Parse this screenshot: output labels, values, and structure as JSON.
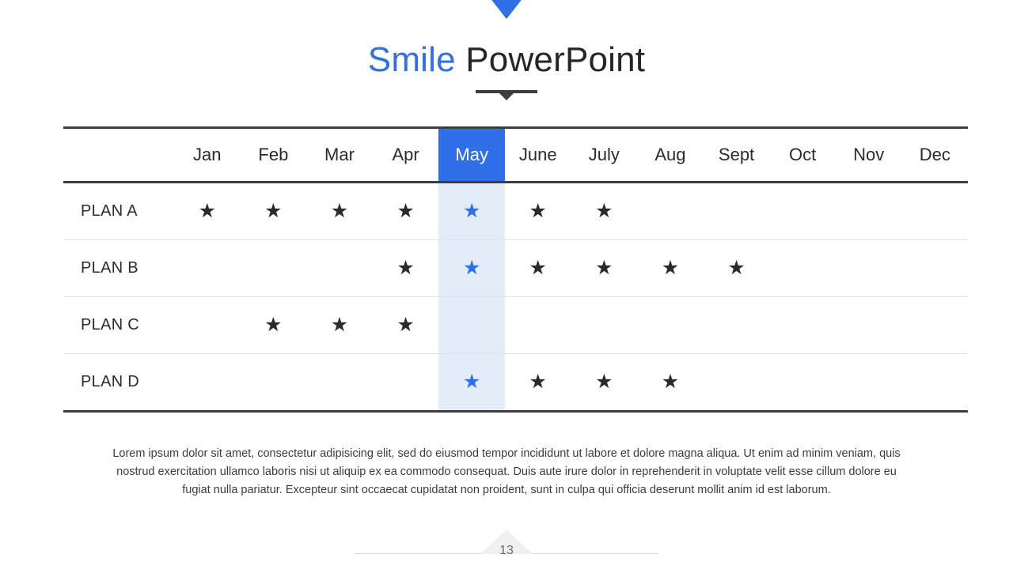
{
  "slide": {
    "title_accent": "Smile",
    "title_rest": " PowerPoint",
    "page_number": "13",
    "accent_color": "#2f6fe8",
    "highlight_fill": "#e3ecf7",
    "star_glyph": "★"
  },
  "table": {
    "row_header_label": "",
    "columns": [
      "Jan",
      "Feb",
      "Mar",
      "Apr",
      "May",
      "June",
      "July",
      "Aug",
      "Sept",
      "Oct",
      "Nov",
      "Dec"
    ],
    "highlighted_column": "May",
    "highlighted_column_index": 4,
    "rows": [
      {
        "label": "PLAN A",
        "marks": [
          true,
          true,
          true,
          true,
          true,
          true,
          true,
          false,
          false,
          false,
          false,
          false
        ]
      },
      {
        "label": "PLAN B",
        "marks": [
          false,
          false,
          false,
          true,
          true,
          true,
          true,
          true,
          true,
          false,
          false,
          false
        ]
      },
      {
        "label": "PLAN C",
        "marks": [
          false,
          true,
          true,
          true,
          false,
          false,
          false,
          false,
          false,
          false,
          false,
          false
        ]
      },
      {
        "label": "PLAN D",
        "marks": [
          false,
          false,
          false,
          false,
          true,
          true,
          true,
          true,
          false,
          false,
          false,
          false
        ]
      }
    ]
  },
  "body": {
    "paragraph": "Lorem ipsum dolor sit amet, consectetur adipisicing elit, sed do eiusmod tempor incididunt ut labore et dolore magna aliqua. Ut enim ad minim veniam, quis nostrud exercitation ullamco laboris nisi ut aliquip ex ea commodo consequat. Duis aute irure dolor in reprehenderit in voluptate velit esse cillum dolore eu fugiat nulla pariatur. Excepteur sint occaecat cupidatat non proident, sunt in culpa qui officia deserunt mollit anim id est laborum."
  }
}
